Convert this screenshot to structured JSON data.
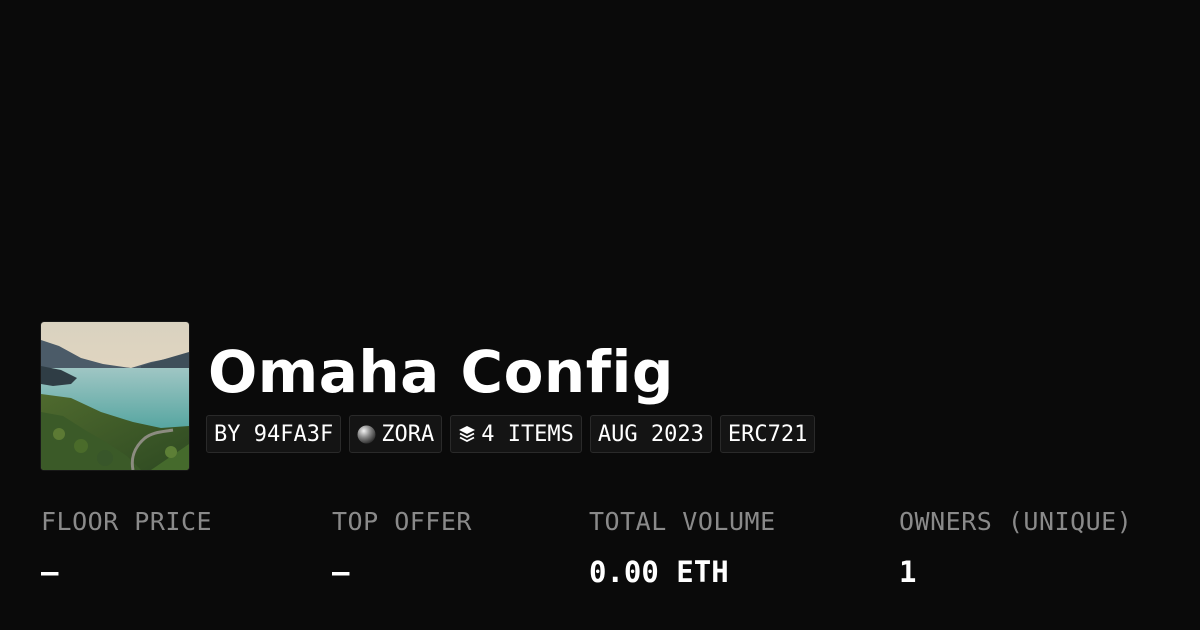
{
  "collection": {
    "name": "Omaha Config",
    "thumbnail_icon": "landscape-lake-image"
  },
  "tags": {
    "creator": "BY 94FA3F",
    "chain": "ZORA",
    "chain_icon": "zora-orb-icon",
    "items": "4 ITEMS",
    "items_icon": "layers-icon",
    "date": "AUG 2023",
    "standard": "ERC721"
  },
  "stats": {
    "floor_price": {
      "label": "FLOOR PRICE",
      "value": "—"
    },
    "top_offer": {
      "label": "TOP OFFER",
      "value": "—"
    },
    "total_volume": {
      "label": "TOTAL VOLUME",
      "value": "0.00 ETH"
    },
    "owners": {
      "label": "OWNERS (UNIQUE)",
      "value": "1"
    }
  },
  "colors": {
    "background": "#0a0a0a",
    "tag_background": "#141414",
    "tag_border": "#2a2a2a",
    "label_gray": "#8a8a8a",
    "text_white": "#ffffff"
  }
}
